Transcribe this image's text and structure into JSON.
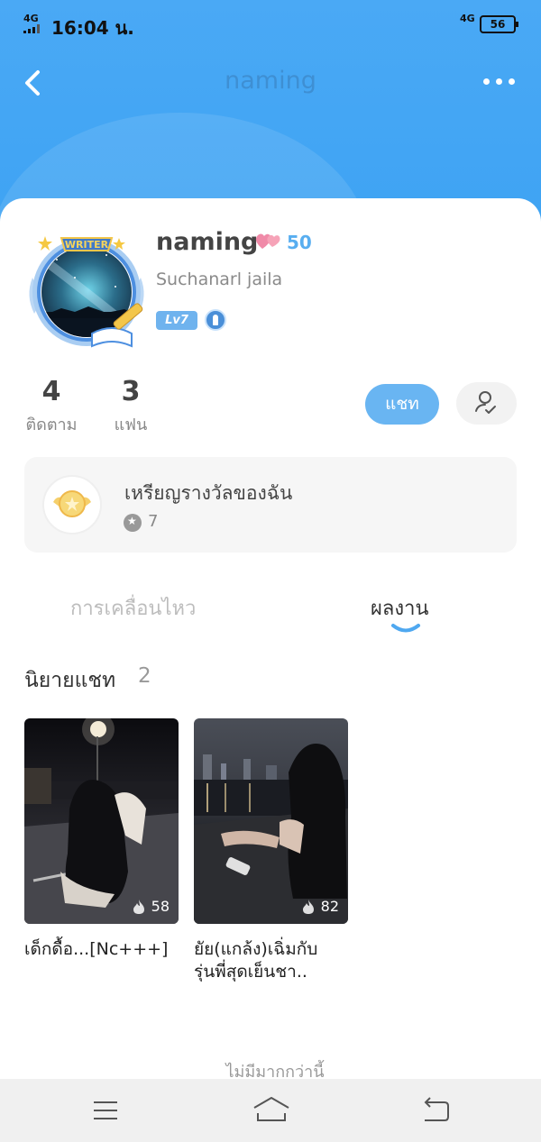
{
  "status_bar": {
    "signal": "4G",
    "time": "16:04 น.",
    "network_right": "4G",
    "battery": "56"
  },
  "topbar": {
    "title": "naming"
  },
  "profile": {
    "avatar_badge_text": "WRITER",
    "nickname": "naming",
    "score": "50",
    "username": "Suchanarl jaila",
    "level": "Lv7"
  },
  "stats": [
    {
      "value": "4",
      "label": "ติดตาม"
    },
    {
      "value": "3",
      "label": "แฟน"
    }
  ],
  "actions": {
    "chat_label": "แชท"
  },
  "medal": {
    "title": "เหรียญรางวัลของฉัน",
    "count": "7"
  },
  "tabs": [
    {
      "label": "การเคลื่อนไหว",
      "active": false
    },
    {
      "label": "ผลงาน",
      "active": true
    }
  ],
  "section": {
    "title": "นิยายแชท",
    "count": "2"
  },
  "novels": [
    {
      "title": "เด็กดื้อ...[Nc+++]",
      "views": "58"
    },
    {
      "title_line1": "ยัย(แกล้ง)เฉิ่มกับ",
      "title_line2": "รุ่นพี่สุดเย็นชา..",
      "views": "82"
    }
  ],
  "footer": {
    "no_more": "ไม่มีมากกว่านี้"
  },
  "colors": {
    "header": "#42a5f5",
    "accent": "#69b5f2",
    "score": "#58aef0"
  }
}
